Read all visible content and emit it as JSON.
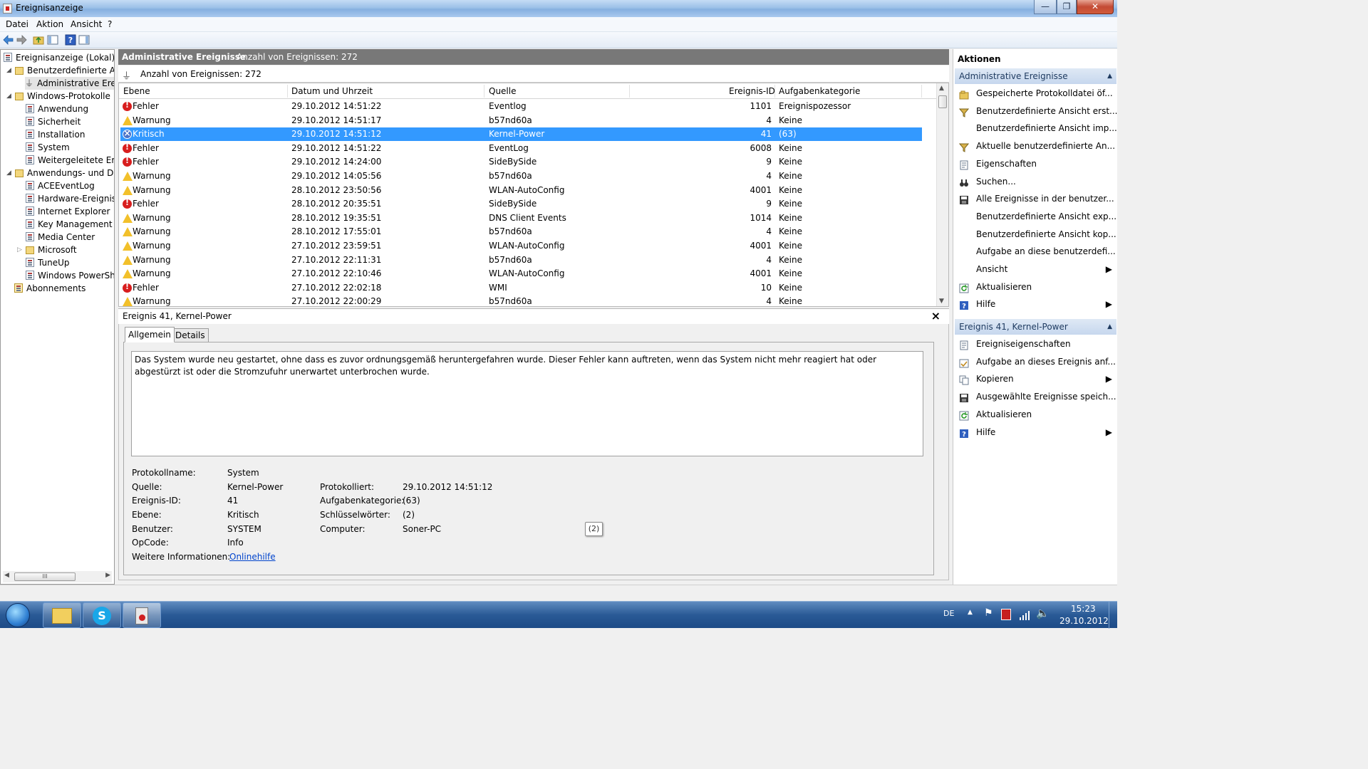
{
  "window": {
    "title": "Ereignisanzeige",
    "min_label": "—",
    "max_label": "❐",
    "close_label": "✕"
  },
  "menu": {
    "datei": "Datei",
    "aktion": "Aktion",
    "ansicht": "Ansicht",
    "help": "?"
  },
  "tree": {
    "root": "Ereignisanzeige (Lokal)",
    "custom_views": "Benutzerdefinierte Ans",
    "admin_events": "Administrative Ereig",
    "windows_logs": "Windows-Protokolle",
    "application": "Anwendung",
    "security": "Sicherheit",
    "setup": "Installation",
    "system": "System",
    "forwarded": "Weitergeleitete Erei",
    "app_services": "Anwendungs- und Dier",
    "ace": "ACEEventLog",
    "hardware": "Hardware-Ereigniss",
    "ie": "Internet Explorer",
    "kms": "Key Management Se",
    "media": "Media Center",
    "microsoft": "Microsoft",
    "tuneup": "TuneUp",
    "powershell": "Windows PowerShe",
    "subscriptions": "Abonnements",
    "scroll_grip": "III"
  },
  "center": {
    "title": "Administrative Ereignisse",
    "count": "Anzahl von Ereignissen: 272",
    "filter_text": "Anzahl von Ereignissen: 272"
  },
  "grid": {
    "columns": {
      "level": "Ebene",
      "datetime": "Datum und Uhrzeit",
      "source": "Quelle",
      "event_id": "Ereignis-ID",
      "category": "Aufgabenkategorie"
    },
    "rows": [
      {
        "level": "Fehler",
        "icon": "error-icon",
        "datetime": "29.10.2012 14:51:22",
        "source": "Eventlog",
        "event_id": "1101",
        "category": "Ereignispozessor"
      },
      {
        "level": "Warnung",
        "icon": "warning-icon",
        "datetime": "29.10.2012 14:51:17",
        "source": "b57nd60a",
        "event_id": "4",
        "category": "Keine"
      },
      {
        "level": "Kritisch",
        "icon": "critical-icon",
        "datetime": "29.10.2012 14:51:12",
        "source": "Kernel-Power",
        "event_id": "41",
        "category": "(63)"
      },
      {
        "level": "Fehler",
        "icon": "error-icon",
        "datetime": "29.10.2012 14:51:22",
        "source": "EventLog",
        "event_id": "6008",
        "category": "Keine"
      },
      {
        "level": "Fehler",
        "icon": "error-icon",
        "datetime": "29.10.2012 14:24:00",
        "source": "SideBySide",
        "event_id": "9",
        "category": "Keine"
      },
      {
        "level": "Warnung",
        "icon": "warning-icon",
        "datetime": "29.10.2012 14:05:56",
        "source": "b57nd60a",
        "event_id": "4",
        "category": "Keine"
      },
      {
        "level": "Warnung",
        "icon": "warning-icon",
        "datetime": "28.10.2012 23:50:56",
        "source": "WLAN-AutoConfig",
        "event_id": "4001",
        "category": "Keine"
      },
      {
        "level": "Fehler",
        "icon": "error-icon",
        "datetime": "28.10.2012 20:35:51",
        "source": "SideBySide",
        "event_id": "9",
        "category": "Keine"
      },
      {
        "level": "Warnung",
        "icon": "warning-icon",
        "datetime": "28.10.2012 19:35:51",
        "source": "DNS Client Events",
        "event_id": "1014",
        "category": "Keine"
      },
      {
        "level": "Warnung",
        "icon": "warning-icon",
        "datetime": "28.10.2012 17:55:01",
        "source": "b57nd60a",
        "event_id": "4",
        "category": "Keine"
      },
      {
        "level": "Warnung",
        "icon": "warning-icon",
        "datetime": "27.10.2012 23:59:51",
        "source": "WLAN-AutoConfig",
        "event_id": "4001",
        "category": "Keine"
      },
      {
        "level": "Warnung",
        "icon": "warning-icon",
        "datetime": "27.10.2012 22:11:31",
        "source": "b57nd60a",
        "event_id": "4",
        "category": "Keine"
      },
      {
        "level": "Warnung",
        "icon": "warning-icon",
        "datetime": "27.10.2012 22:10:46",
        "source": "WLAN-AutoConfig",
        "event_id": "4001",
        "category": "Keine"
      },
      {
        "level": "Fehler",
        "icon": "error-icon",
        "datetime": "27.10.2012 22:02:18",
        "source": "WMI",
        "event_id": "10",
        "category": "Keine"
      },
      {
        "level": "Warnung",
        "icon": "warning-icon",
        "datetime": "27.10.2012 22:00:29",
        "source": "b57nd60a",
        "event_id": "4",
        "category": "Keine"
      }
    ],
    "selected_index": 2
  },
  "detail": {
    "title": "Ereignis 41, Kernel-Power",
    "close": "×",
    "tab_general": "Allgemein",
    "tab_details": "Details",
    "description": "Das System wurde neu gestartet, ohne dass es zuvor ordnungsgemäß heruntergefahren wurde. Dieser Fehler kann auftreten, wenn das System nicht mehr reagiert hat oder abgestürzt ist oder die Stromzufuhr unerwartet unterbrochen wurde.",
    "labels": {
      "log_name": "Protokollname:",
      "source": "Quelle:",
      "event_id": "Ereignis-ID:",
      "level": "Ebene:",
      "user": "Benutzer:",
      "opcode": "OpCode:",
      "more_info": "Weitere Informationen:",
      "logged": "Protokolliert:",
      "task_category": "Aufgabenkategorie:",
      "keywords": "Schlüsselwörter:",
      "computer": "Computer:"
    },
    "values": {
      "log_name": "System",
      "source": "Kernel-Power",
      "event_id": "41",
      "level": "Kritisch",
      "user": "SYSTEM",
      "opcode": "Info",
      "more_info": "Onlinehilfe",
      "logged": "29.10.2012 14:51:12",
      "task_category": "(63)",
      "keywords": "(2)",
      "computer": "Soner-PC"
    },
    "tooltip": "(2)"
  },
  "actions": {
    "title": "Aktionen",
    "section1": "Administrative Ereignisse",
    "items1": [
      {
        "label": "Gespeicherte Protokolldatei öf...",
        "icon": "open-folder-icon",
        "arrow": ""
      },
      {
        "label": "Benutzerdefinierte Ansicht erst...",
        "icon": "filter-icon",
        "arrow": ""
      },
      {
        "label": "Benutzerdefinierte Ansicht imp...",
        "icon": "",
        "arrow": ""
      },
      {
        "label": "Aktuelle benutzerdefinierte An...",
        "icon": "filter-icon",
        "arrow": ""
      },
      {
        "label": "Eigenschaften",
        "icon": "properties-icon",
        "arrow": ""
      },
      {
        "label": "Suchen...",
        "icon": "binoculars-icon",
        "arrow": ""
      },
      {
        "label": "Alle Ereignisse in der benutzer...",
        "icon": "save-icon",
        "arrow": ""
      },
      {
        "label": "Benutzerdefinierte Ansicht exp...",
        "icon": "",
        "arrow": ""
      },
      {
        "label": "Benutzerdefinierte Ansicht kop...",
        "icon": "",
        "arrow": ""
      },
      {
        "label": "Aufgabe an diese benutzerdefi...",
        "icon": "",
        "arrow": ""
      },
      {
        "label": "Ansicht",
        "icon": "",
        "arrow": "▶"
      },
      {
        "label": "Aktualisieren",
        "icon": "refresh-icon",
        "arrow": ""
      },
      {
        "label": "Hilfe",
        "icon": "help-icon",
        "arrow": "▶"
      }
    ],
    "section2": "Ereignis 41, Kernel-Power",
    "items2": [
      {
        "label": "Ereigniseigenschaften",
        "icon": "properties-icon",
        "arrow": ""
      },
      {
        "label": "Aufgabe an dieses Ereignis anf...",
        "icon": "task-icon",
        "arrow": ""
      },
      {
        "label": "Kopieren",
        "icon": "copy-icon",
        "arrow": "▶"
      },
      {
        "label": "Ausgewählte Ereignisse speich...",
        "icon": "save-icon",
        "arrow": ""
      },
      {
        "label": "Aktualisieren",
        "icon": "refresh-icon",
        "arrow": ""
      },
      {
        "label": "Hilfe",
        "icon": "help-icon",
        "arrow": "▶"
      }
    ],
    "collapse": "▲"
  },
  "taskbar": {
    "lang": "DE",
    "time": "15:23",
    "date": "29.10.2012"
  },
  "colors": {
    "selection": "#3399ff",
    "error": "#d81e1e",
    "warning": "#f2c02a",
    "critical": "#4a72c8",
    "header_bar": "#787878"
  }
}
